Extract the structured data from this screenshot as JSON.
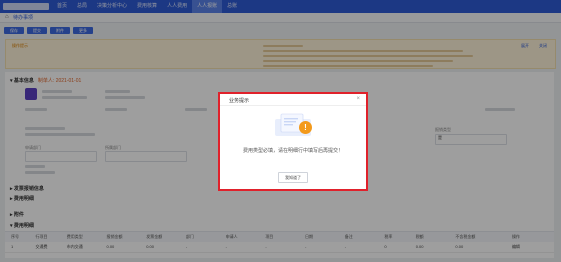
{
  "nav": {
    "items": [
      "首页",
      "总局",
      "决策分析中心",
      "费用核算",
      "人人费用",
      "人人报账",
      "总账"
    ],
    "active_index": 5
  },
  "tab_home": "待办事项",
  "toolbar": {
    "buttons": [
      "保存",
      "提交",
      "附件",
      "更多"
    ]
  },
  "notice": {
    "title": "操作提示",
    "links": [
      "展开",
      "关闭"
    ]
  },
  "section_basic": {
    "title": "基本信息",
    "subtitle": "制单人: 2021-01-01"
  },
  "form": {
    "label_1": "申请部门",
    "label_2": "所属部门",
    "label_3": "报销类型",
    "select_value": "是"
  },
  "section_2": "发票报销信息",
  "section_3": "费用明细",
  "section_4": "附件",
  "section_5": "费用明细",
  "table": {
    "headers": [
      "序号",
      "行项目",
      "费用类型",
      "报销金额",
      "发票金额",
      "部门",
      "申请人",
      "项目",
      "日期",
      "备注",
      "税率",
      "税额",
      "不含税金额",
      "操作"
    ],
    "row": [
      "1",
      "交通费",
      "市内交通",
      "0.00",
      "0.00",
      "-",
      "-",
      "-",
      "-",
      "-",
      "0",
      "0.00",
      "0.00",
      "编辑"
    ]
  },
  "modal": {
    "title": "业务提示",
    "close": "×",
    "message": "费用类型必填，请在明细行中填写后再提交！",
    "confirm": "我知道了",
    "warning_glyph": "!"
  },
  "colors": {
    "nav": "#2e5bd6",
    "warning": "#f39a1c",
    "highlight_border": "#e0212b"
  }
}
